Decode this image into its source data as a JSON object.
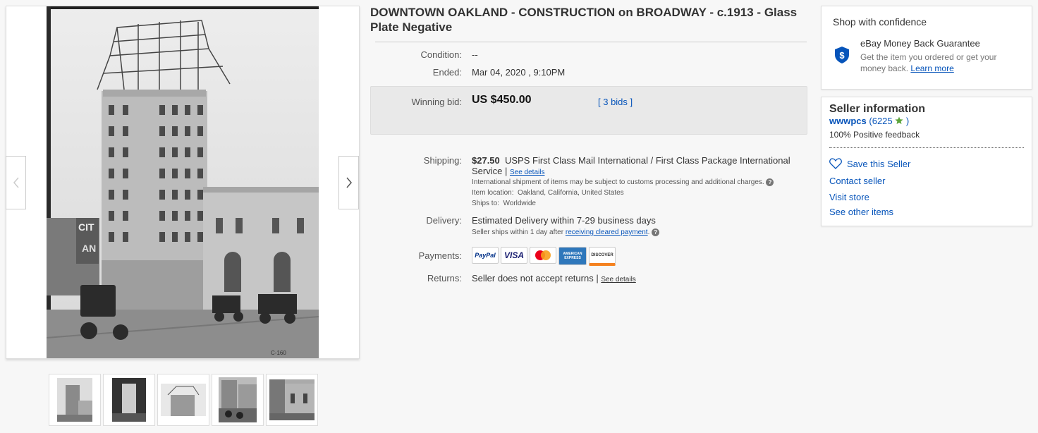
{
  "listing": {
    "title": "DOWNTOWN OAKLAND - CONSTRUCTION on BROADWAY - c.1913 - Glass Plate Negative",
    "condition_label": "Condition:",
    "condition_value": "--",
    "ended_label": "Ended:",
    "ended_value": "Mar 04, 2020 , 9:10PM",
    "winning_bid_label": "Winning bid:",
    "winning_bid_value": "US $450.00",
    "bids_link": "[ 3 bids ]",
    "shipping_label": "Shipping:",
    "shipping_price": "$27.50",
    "shipping_service": "USPS First Class Mail International / First Class Package International Service |",
    "shipping_see_details": "See details",
    "intl_note": "International shipment of items may be subject to customs processing and additional charges.",
    "item_location_label": "Item location:",
    "item_location_value": "Oakland, California, United States",
    "ships_to_label": "Ships to:",
    "ships_to_value": "Worldwide",
    "delivery_label": "Delivery:",
    "delivery_value": "Estimated Delivery within 7-29 business days",
    "delivery_note_prefix": "Seller ships within 1 day after",
    "delivery_note_link": "receiving cleared payment",
    "delivery_note_suffix": ".",
    "payments_label": "Payments:",
    "payment_methods": [
      "PayPal",
      "VISA",
      "MasterCard",
      "AMERICAN EXPRESS",
      "DISCOVER"
    ],
    "returns_label": "Returns:",
    "returns_value": "Seller does not accept returns |",
    "returns_see_details": "See details"
  },
  "gallery": {
    "prev_icon": "chevron-left-icon",
    "next_icon": "chevron-right-icon",
    "photo_sign_text": "CIT",
    "photo_sign_text2": "AN",
    "photo_plate_mark": "C-160",
    "thumbnail_count": 5
  },
  "confidence": {
    "heading": "Shop with confidence",
    "guarantee_title": "eBay Money Back Guarantee",
    "guarantee_text": "Get the item you ordered or get your money back.",
    "learn_more": "Learn more",
    "icon": "shield-dollar-icon"
  },
  "seller": {
    "heading": "Seller information",
    "username": "wwwpcs",
    "feedback_open": "(",
    "feedback_score": "6225",
    "feedback_close": ")",
    "positive": "100% Positive feedback",
    "save_seller": "Save this Seller",
    "contact": "Contact seller",
    "visit_store": "Visit store",
    "other_items": "See other items"
  },
  "colors": {
    "link": "#0654ba",
    "bid_box": "#e9e9e9",
    "shield": "#0654ba",
    "star": "#5ba43a"
  }
}
